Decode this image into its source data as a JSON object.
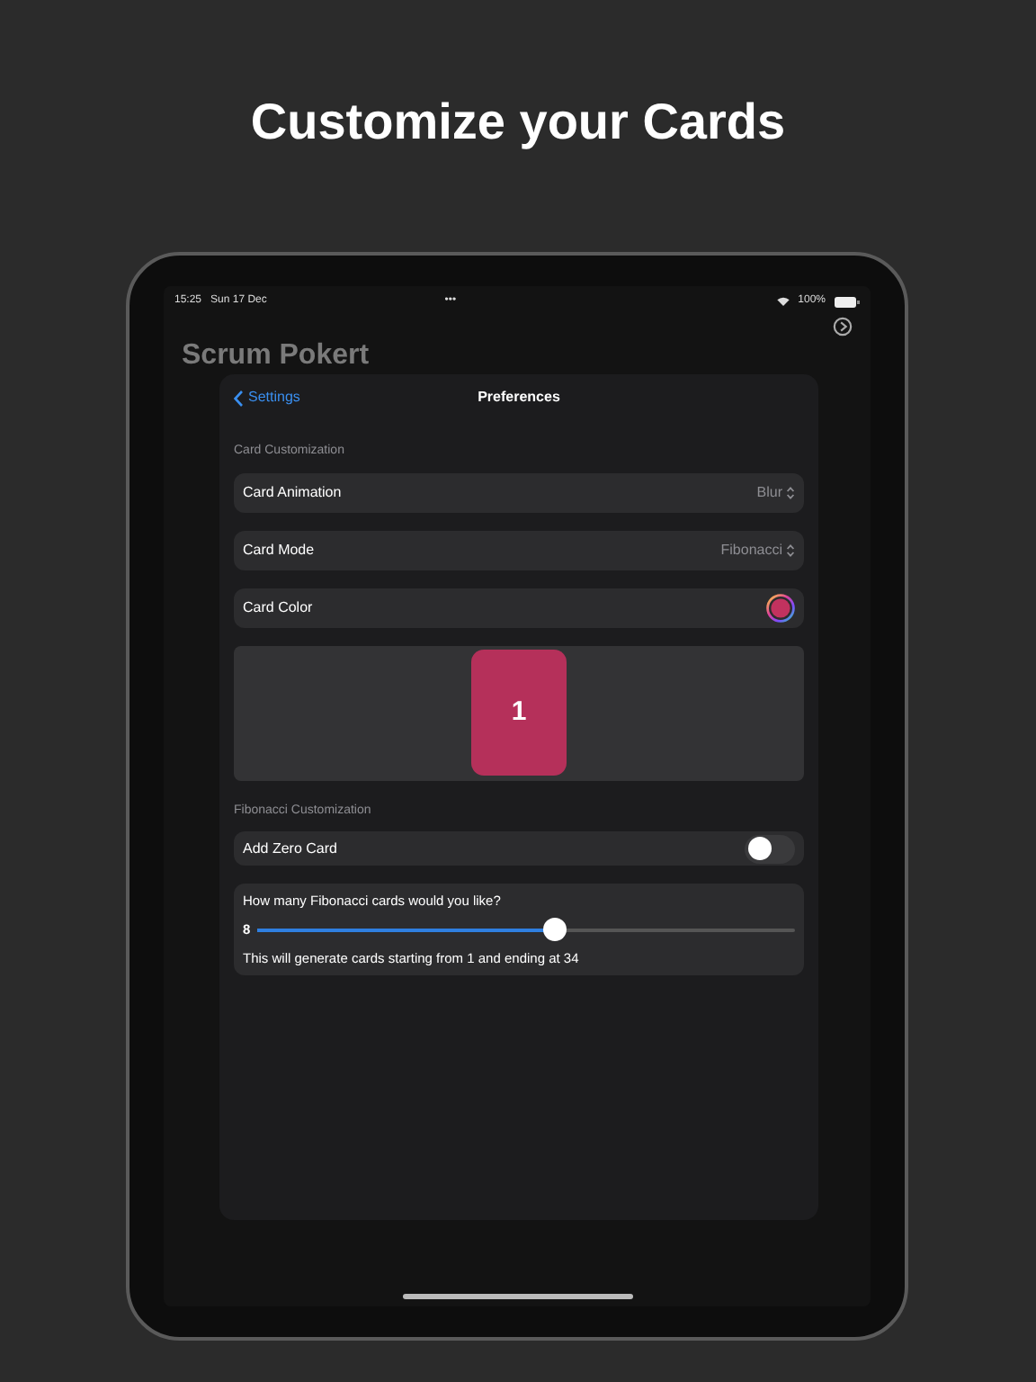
{
  "headline": "Customize your Cards",
  "status_bar": {
    "time": "15:25",
    "date": "Sun 17 Dec",
    "dots": "•••",
    "battery": "100%"
  },
  "app_title": "Scrum Pokert",
  "sheet": {
    "back": "Settings",
    "title": "Preferences",
    "sections": [
      {
        "header": "Card Customization",
        "rows": [
          {
            "kind": "picker",
            "label": "Card Animation",
            "value": "Blur"
          },
          {
            "kind": "picker",
            "label": "Card Mode",
            "value": "Fibonacci"
          },
          {
            "kind": "color",
            "label": "Card Color",
            "color": "#c2325f"
          },
          {
            "kind": "preview",
            "card": "1",
            "color": "#b5305a"
          }
        ]
      },
      {
        "header": "Fibonacci Customization",
        "rows": [
          {
            "kind": "toggle",
            "label": "Add Zero Card",
            "on": false
          },
          {
            "kind": "slider",
            "question": "How many Fibonacci cards would you like?",
            "reading": "8",
            "level": 0.55,
            "note": "This will generate cards starting from 1 and ending at 34"
          }
        ]
      }
    ]
  }
}
